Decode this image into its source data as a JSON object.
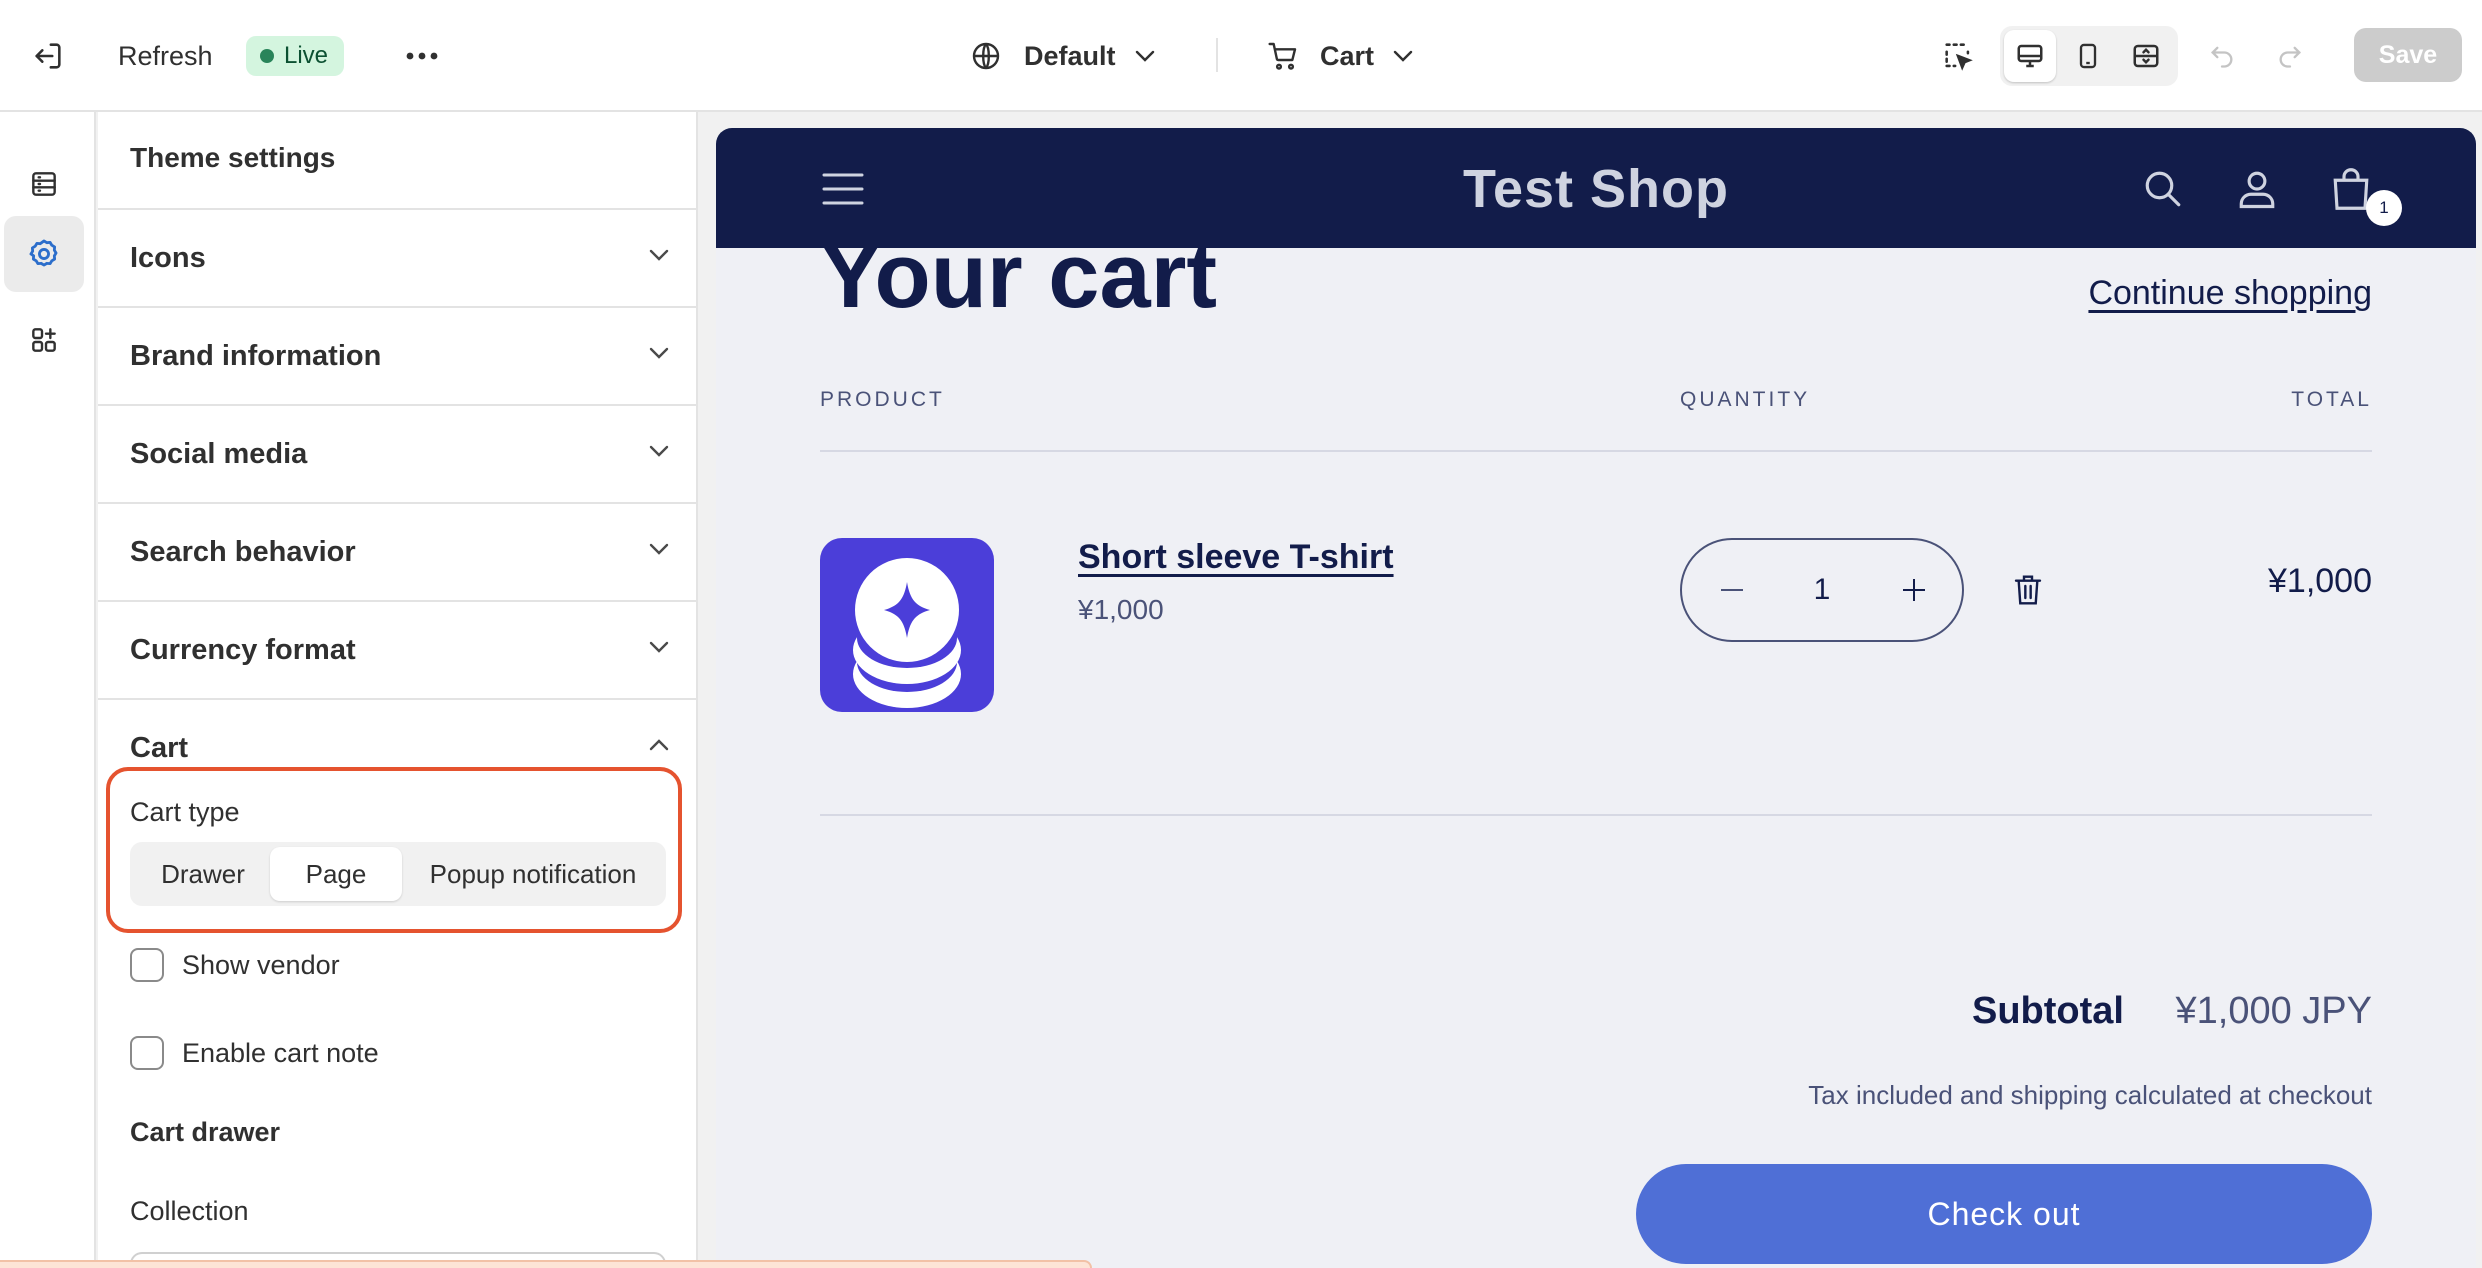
{
  "topbar": {
    "refresh_label": "Refresh",
    "live_label": "Live",
    "theme_label": "Default",
    "page_label": "Cart",
    "save_label": "Save"
  },
  "panel": {
    "title": "Theme settings",
    "sections": [
      {
        "label": "Icons",
        "expanded": false
      },
      {
        "label": "Brand information",
        "expanded": false
      },
      {
        "label": "Social media",
        "expanded": false
      },
      {
        "label": "Search behavior",
        "expanded": false
      },
      {
        "label": "Currency format",
        "expanded": false
      },
      {
        "label": "Cart",
        "expanded": true
      }
    ],
    "cart": {
      "cart_type_label": "Cart type",
      "options": [
        "Drawer",
        "Page",
        "Popup notification"
      ],
      "selected": "Page",
      "show_vendor_label": "Show vendor",
      "show_vendor_checked": false,
      "cart_note_label": "Enable cart note",
      "cart_note_checked": false,
      "cart_drawer_heading": "Cart drawer",
      "collection_label": "Collection"
    }
  },
  "preview": {
    "shop_name": "Test Shop",
    "cart_count": "1",
    "page_title": "Your cart",
    "continue_label": "Continue shopping",
    "columns": {
      "product": "PRODUCT",
      "quantity": "QUANTITY",
      "total": "TOTAL"
    },
    "item": {
      "name": "Short sleeve T-shirt",
      "price": "¥1,000",
      "quantity": "1",
      "total": "¥1,000"
    },
    "subtotal_label": "Subtotal",
    "subtotal_value": "¥1,000 JPY",
    "tax_note": "Tax included and shipping calculated at checkout",
    "checkout_label": "Check out"
  },
  "colors": {
    "shop_header": "#121c4a",
    "checkout_button": "#4f6fd6",
    "live_badge": "#d4f5df",
    "highlight": "#e5532f",
    "product_image": "#4b3ed9"
  }
}
